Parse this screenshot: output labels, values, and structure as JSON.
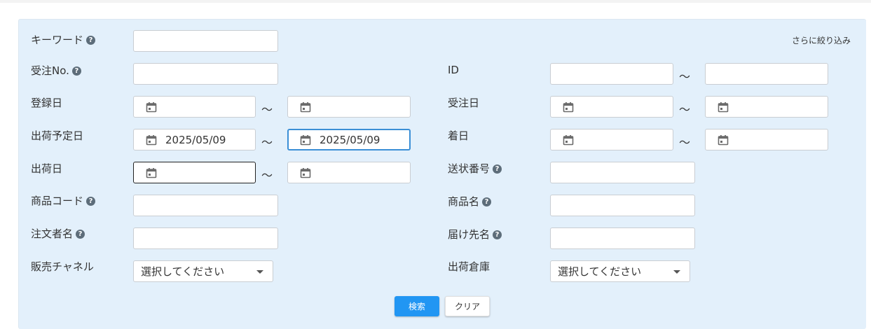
{
  "more_filter_label": "さらに絞り込み",
  "help_glyph": "?",
  "range_separator": "～",
  "fields": {
    "keyword": {
      "label": "キーワード",
      "value": ""
    },
    "order_no": {
      "label": "受注No.",
      "value": ""
    },
    "id": {
      "label": "ID",
      "from": "",
      "to": ""
    },
    "registered_date": {
      "label": "登録日",
      "from": "",
      "to": ""
    },
    "order_date": {
      "label": "受注日",
      "from": "",
      "to": ""
    },
    "ship_plan_date": {
      "label": "出荷予定日",
      "from": "2025/05/09",
      "to": "2025/05/09"
    },
    "arrival_date": {
      "label": "着日",
      "from": "",
      "to": ""
    },
    "ship_date": {
      "label": "出荷日",
      "from": "",
      "to": ""
    },
    "invoice_no": {
      "label": "送状番号",
      "value": ""
    },
    "product_code": {
      "label": "商品コード",
      "value": ""
    },
    "product_name": {
      "label": "商品名",
      "value": ""
    },
    "orderer_name": {
      "label": "注文者名",
      "value": ""
    },
    "recipient_name": {
      "label": "届け先名",
      "value": ""
    },
    "sales_channel": {
      "label": "販売チャネル",
      "selected": "選択してください"
    },
    "warehouse": {
      "label": "出荷倉庫",
      "selected": "選択してください"
    }
  },
  "buttons": {
    "search": "検索",
    "clear": "クリア"
  },
  "icons": {
    "help": "help-circle-icon",
    "calendar": "calendar-icon",
    "dropdown": "caret-down-icon"
  },
  "colors": {
    "panel_bg": "#e3f0fb",
    "primary": "#2196f3",
    "focus_border": "#3b8fd6",
    "help_icon": "#5d6d7a"
  }
}
